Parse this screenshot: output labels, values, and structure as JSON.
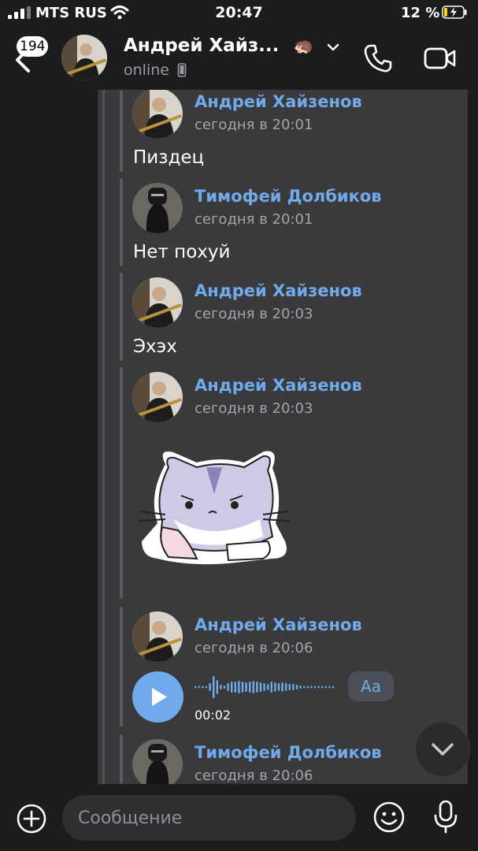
{
  "status_bar": {
    "carrier": "MTS RUS",
    "time": "20:47",
    "battery": "12 %"
  },
  "header": {
    "unread_count": "194",
    "title": "Андрей Хайз...",
    "emoji": "🦔",
    "status": "online"
  },
  "messages": [
    {
      "sender": "Андрей Хайзенов",
      "time": "сегодня в 20:01",
      "text": "Пиздец"
    },
    {
      "sender": "Тимофей Долбиков",
      "time": "сегодня в 20:01",
      "text": "Нет похуй"
    },
    {
      "sender": "Андрей Хайзенов",
      "time": "сегодня в 20:03",
      "text": "Эхэх"
    },
    {
      "sender": "Андрей Хайзенов",
      "time": "сегодня в 20:03",
      "sticker": "sad-cat-sticker"
    },
    {
      "sender": "Андрей Хайзенов",
      "time": "сегодня в 20:06",
      "voice_duration": "00:02",
      "transcribe_label": "Aa"
    },
    {
      "sender": "Тимофей Долбиков",
      "time": "сегодня в 20:06"
    }
  ],
  "composer": {
    "placeholder": "Сообщение"
  },
  "icons": [
    "back-icon",
    "chevron-down-icon",
    "phone-icon",
    "video-icon",
    "play-icon",
    "plus-icon",
    "smile-icon",
    "mic-icon",
    "scroll-down-icon"
  ],
  "colors": {
    "accent": "#71aaeb",
    "background": "#1c1c1e",
    "bubble": "#3a3a3c"
  }
}
